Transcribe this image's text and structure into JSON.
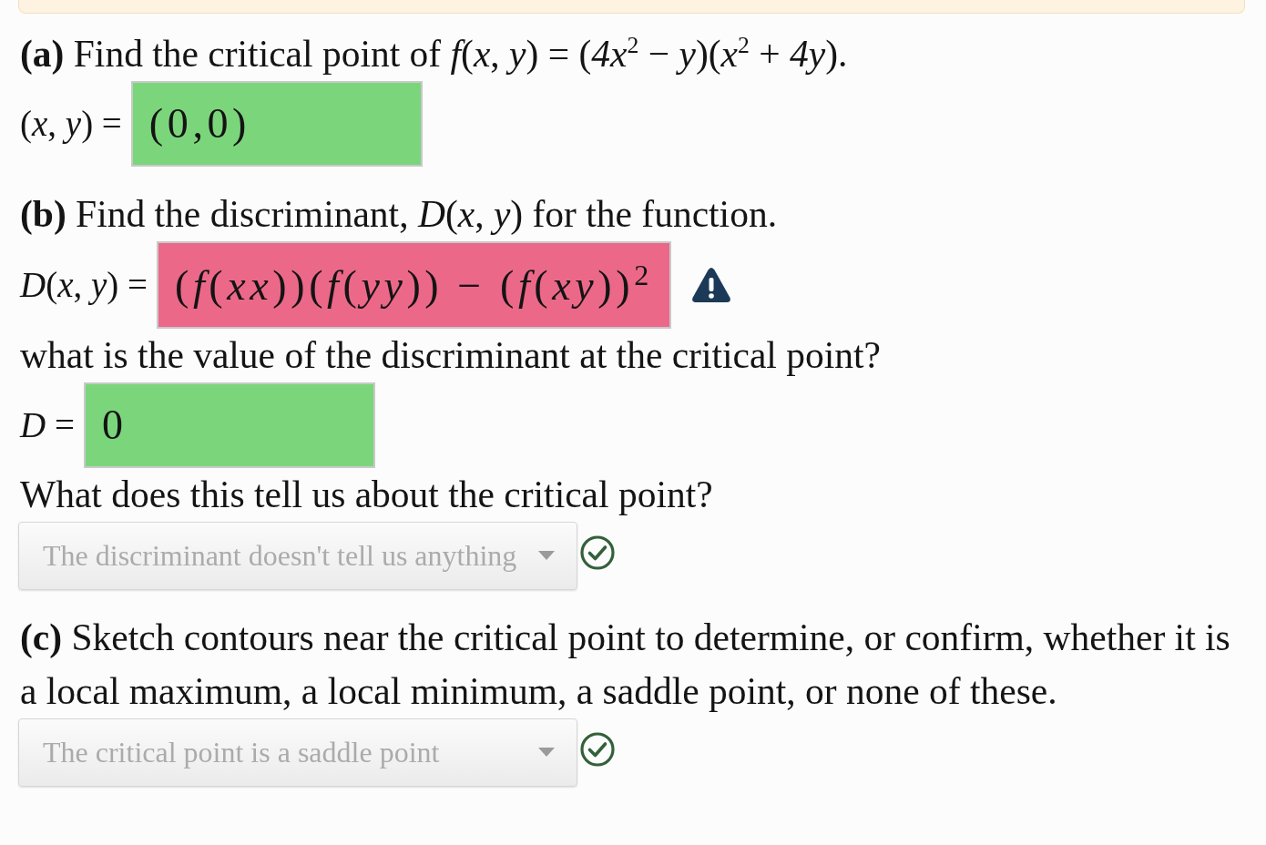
{
  "parts": [
    {
      "items": [
        {
          "kind": "prompt",
          "text": "**(a)** Find the critical point of *f*(*x*, *y*) = (*4x*$^{2}$ − *y*)(*x*$^{2}$ + *4y*)."
        },
        {
          "kind": "math_answer",
          "label": "(*x*, *y*) =",
          "value": "(0,0)",
          "correct": true
        }
      ]
    },
    {
      "items": [
        {
          "kind": "prompt",
          "text": "**(b)** Find the discriminant, *D*(*x*, *y*) for the function."
        },
        {
          "kind": "math_answer",
          "label": "*D*(*x*, *y*) =",
          "value": "(*f*(*xx*))(*f*(*yy*)) − (*f*(*xy*))$^{2}$",
          "correct": false
        },
        {
          "kind": "prompt",
          "text": "what is the value of the discriminant at the critical point?"
        },
        {
          "kind": "math_answer",
          "label": "*D* =",
          "value": "0",
          "correct": true
        },
        {
          "kind": "prompt",
          "text": "What does this tell us about the critical point?"
        },
        {
          "kind": "dropdown",
          "value": "The discriminant doesn't tell us anything",
          "correct": true,
          "disabled": true
        }
      ]
    },
    {
      "items": [
        {
          "kind": "prompt",
          "text": "**(c)** Sketch contours near the critical point to determine, or confirm, whether it is a local maximum, a local minimum, a saddle point, or none of these."
        },
        {
          "kind": "dropdown",
          "value": "The critical point is a saddle point",
          "correct": true,
          "disabled": true
        }
      ]
    }
  ]
}
